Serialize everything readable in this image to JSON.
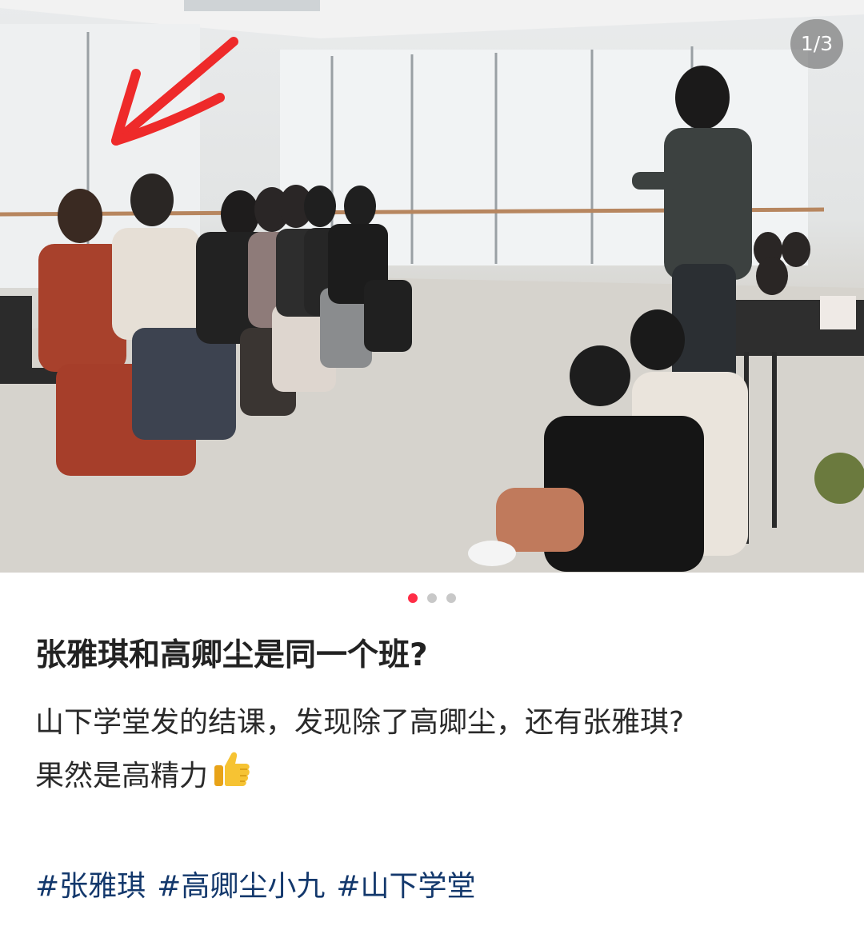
{
  "post": {
    "image_counter": "1/3",
    "carousel": {
      "total": 3,
      "active_index": 0
    },
    "title": "张雅琪和高卿尘是同一个班?",
    "description": {
      "line1": "山下学堂发的结课，发现除了高卿尘，还有张雅琪?",
      "line2": "果然是高精力"
    },
    "emoji_icon": "thumbs-up-icon",
    "tags": [
      "#张雅琪",
      "#高卿尘小九",
      "#山下学堂"
    ],
    "colors": {
      "active_dot": "#ff2d46",
      "inactive_dot": "#c8c8c8",
      "tag_text": "#13386c",
      "arrow": "#ee2a2a"
    }
  }
}
